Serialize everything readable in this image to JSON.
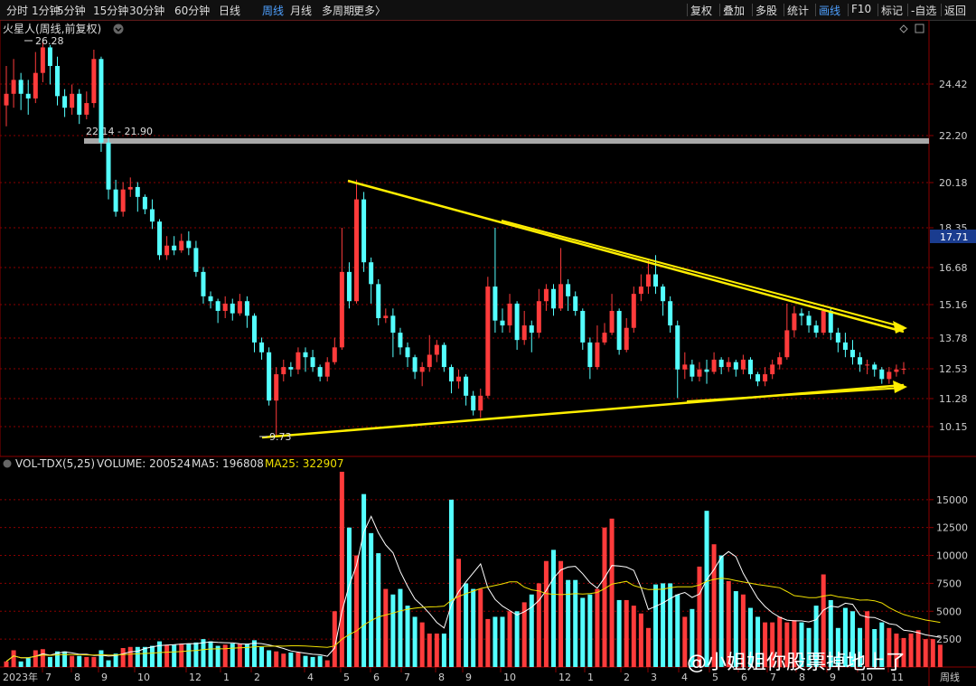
{
  "toolbar": {
    "left_items": [
      "分时",
      "1分钟",
      "5分钟",
      "15分钟",
      "30分钟",
      "60分钟",
      "日线",
      "周线",
      "月线",
      "多周期",
      "更多〉"
    ],
    "active_left": "周线",
    "right_items": [
      "复权",
      "叠加",
      "多股",
      "统计",
      "画线",
      "F10",
      "标记",
      "-自选",
      "返回"
    ],
    "active_right": "画线"
  },
  "header": {
    "title": "火星人(周线,前复权)",
    "dropdown_icon": "chevron-down-icon",
    "corner_icons": [
      "diamond-icon",
      "window-icon"
    ]
  },
  "colors": {
    "up": "#ff3b3b",
    "down": "#54ffff",
    "ma5": "#ffffff",
    "ma25": "#f0e000",
    "grid": "#8b0000",
    "trend": "#ffee00",
    "level": "#a8a8a8"
  },
  "price_axis": {
    "ticks": [
      "24.42",
      "22.20",
      "20.18",
      "18.35",
      "16.68",
      "15.16",
      "13.78",
      "12.53",
      "11.28",
      "10.15"
    ],
    "current_price": "17.71"
  },
  "annotations": {
    "high_label": "26.28",
    "low_label": "9.73",
    "level_label": "22.14 - 21.90"
  },
  "volume": {
    "indicator": "VOL-TDX(5,25)",
    "volume_label": "VOLUME: 200524",
    "ma5_label": "MA5: 196808",
    "ma25_label": "MA25: 322907",
    "ticks": [
      "15000",
      "12500",
      "10000",
      "7500",
      "5000",
      "2500"
    ]
  },
  "time_axis": {
    "labels": [
      "2023年",
      "7",
      "8",
      "9",
      "10",
      "12",
      "1",
      "2",
      "4",
      "5",
      "6",
      "7",
      "8",
      "9",
      "10",
      "12",
      "1",
      "2",
      "3",
      "4",
      "5",
      "6",
      "7",
      "8",
      "9",
      "10",
      "11"
    ],
    "period_label": "周线"
  },
  "watermark": "@小姐姐你股票掉地上了",
  "chart_data": {
    "type": "candlestick",
    "title": "火星人(周线,前复权)",
    "y_axis_ticks": [
      24.42,
      22.2,
      20.18,
      18.35,
      16.68,
      15.16,
      13.78,
      12.53,
      11.28,
      10.15
    ],
    "annotated_high": 26.28,
    "annotated_low": 9.73,
    "current_price": 17.71,
    "horizontal_level": [
      22.14,
      21.9
    ],
    "series": [
      {
        "name": "MA5"
      },
      {
        "name": "MA25"
      }
    ],
    "ohlc": [
      [
        23.5,
        24.0,
        25.2,
        22.6
      ],
      [
        24.0,
        24.6,
        25.5,
        23.4
      ],
      [
        24.6,
        24.0,
        24.9,
        23.3
      ],
      [
        24.0,
        23.8,
        24.6,
        23.1
      ],
      [
        23.8,
        24.9,
        25.8,
        23.6
      ],
      [
        24.9,
        26.0,
        26.28,
        24.5
      ],
      [
        26.0,
        25.2,
        26.1,
        24.4
      ],
      [
        25.2,
        23.9,
        25.6,
        23.5
      ],
      [
        23.9,
        23.4,
        24.2,
        23.0
      ],
      [
        23.4,
        24.0,
        24.4,
        23.1
      ],
      [
        24.0,
        23.1,
        24.2,
        22.7
      ],
      [
        23.1,
        23.6,
        24.1,
        22.9
      ],
      [
        23.6,
        25.5,
        25.9,
        23.4
      ],
      [
        25.5,
        21.9,
        25.6,
        21.5
      ],
      [
        21.9,
        19.9,
        22.1,
        19.5
      ],
      [
        19.9,
        19.0,
        20.3,
        18.8
      ],
      [
        19.0,
        19.9,
        20.2,
        18.8
      ],
      [
        19.9,
        20.0,
        20.4,
        19.6
      ],
      [
        20.0,
        19.6,
        20.2,
        19.0
      ],
      [
        19.6,
        19.1,
        19.7,
        18.9
      ],
      [
        19.1,
        18.6,
        19.5,
        18.3
      ],
      [
        18.6,
        17.2,
        18.7,
        17.0
      ],
      [
        17.2,
        17.6,
        18.0,
        17.0
      ],
      [
        17.6,
        17.4,
        18.0,
        17.2
      ],
      [
        17.4,
        17.8,
        18.1,
        17.3
      ],
      [
        17.8,
        17.5,
        18.2,
        17.2
      ],
      [
        17.5,
        16.5,
        17.8,
        16.3
      ],
      [
        16.5,
        15.5,
        16.7,
        15.2
      ],
      [
        15.5,
        15.3,
        15.7,
        15.0
      ],
      [
        15.3,
        14.9,
        15.4,
        14.4
      ],
      [
        14.9,
        15.2,
        15.5,
        14.6
      ],
      [
        15.2,
        14.8,
        15.4,
        14.5
      ],
      [
        14.8,
        15.3,
        15.6,
        14.7
      ],
      [
        15.3,
        14.7,
        15.5,
        14.2
      ],
      [
        14.7,
        13.6,
        14.8,
        13.2
      ],
      [
        13.6,
        13.2,
        13.8,
        12.9
      ],
      [
        13.2,
        11.2,
        13.4,
        11.0
      ],
      [
        11.2,
        12.3,
        12.6,
        9.73
      ],
      [
        12.3,
        12.6,
        12.9,
        12.0
      ],
      [
        12.6,
        12.5,
        12.8,
        12.2
      ],
      [
        12.5,
        13.2,
        13.4,
        12.3
      ],
      [
        13.2,
        13.0,
        13.4,
        12.4
      ],
      [
        13.0,
        12.6,
        13.3,
        12.4
      ],
      [
        12.6,
        12.2,
        12.7,
        12.0
      ],
      [
        12.2,
        12.8,
        13.0,
        12.0
      ],
      [
        12.8,
        13.4,
        13.8,
        12.7
      ],
      [
        13.4,
        16.5,
        18.35,
        13.3
      ],
      [
        16.5,
        15.3,
        16.9,
        15.0
      ],
      [
        15.3,
        19.5,
        20.3,
        15.2
      ],
      [
        19.5,
        16.9,
        19.8,
        16.5
      ],
      [
        16.9,
        16.0,
        17.1,
        15.2
      ],
      [
        16.0,
        14.6,
        16.2,
        14.3
      ],
      [
        14.6,
        14.7,
        15.0,
        14.4
      ],
      [
        14.7,
        14.0,
        15.0,
        13.0
      ],
      [
        14.0,
        13.4,
        14.2,
        13.1
      ],
      [
        13.4,
        13.0,
        13.6,
        12.6
      ],
      [
        13.0,
        12.4,
        13.1,
        12.1
      ],
      [
        12.4,
        12.6,
        12.8,
        11.8
      ],
      [
        12.6,
        13.1,
        13.9,
        12.4
      ],
      [
        13.1,
        13.5,
        13.7,
        12.8
      ],
      [
        13.5,
        12.6,
        13.6,
        12.4
      ],
      [
        12.6,
        12.0,
        12.7,
        11.5
      ],
      [
        12.0,
        12.2,
        12.5,
        11.7
      ],
      [
        12.2,
        11.4,
        12.3,
        11.0
      ],
      [
        11.4,
        10.8,
        11.6,
        10.6
      ],
      [
        10.8,
        11.4,
        11.7,
        10.5
      ],
      [
        11.4,
        15.9,
        16.3,
        11.3
      ],
      [
        15.9,
        14.5,
        18.35,
        14.0
      ],
      [
        14.5,
        14.3,
        15.0,
        14.0
      ],
      [
        14.3,
        15.2,
        15.6,
        14.0
      ],
      [
        15.2,
        13.7,
        15.3,
        13.3
      ],
      [
        13.7,
        14.3,
        14.9,
        13.5
      ],
      [
        14.3,
        14.0,
        14.5,
        13.2
      ],
      [
        14.0,
        15.3,
        15.8,
        13.8
      ],
      [
        15.3,
        15.8,
        16.0,
        14.9
      ],
      [
        15.8,
        15.0,
        16.0,
        14.7
      ],
      [
        15.0,
        16.0,
        17.5,
        14.9
      ],
      [
        16.0,
        15.5,
        16.2,
        14.9
      ],
      [
        15.5,
        14.9,
        15.7,
        14.7
      ],
      [
        14.9,
        13.6,
        15.0,
        13.3
      ],
      [
        13.6,
        12.6,
        13.8,
        12.1
      ],
      [
        12.6,
        13.6,
        14.3,
        12.5
      ],
      [
        13.6,
        14.0,
        14.4,
        13.5
      ],
      [
        14.0,
        14.9,
        15.6,
        13.9
      ],
      [
        14.9,
        13.3,
        15.0,
        13.1
      ],
      [
        13.3,
        14.2,
        14.6,
        13.2
      ],
      [
        14.2,
        15.6,
        15.9,
        14.0
      ],
      [
        15.6,
        15.9,
        16.4,
        15.3
      ],
      [
        15.9,
        16.4,
        17.0,
        15.6
      ],
      [
        16.4,
        15.9,
        17.2,
        15.6
      ],
      [
        15.9,
        15.3,
        16.0,
        14.7
      ],
      [
        15.3,
        14.3,
        15.5,
        14.0
      ],
      [
        14.3,
        12.5,
        14.5,
        11.3
      ],
      [
        12.5,
        12.7,
        13.2,
        12.1
      ],
      [
        12.7,
        12.2,
        12.9,
        12.0
      ],
      [
        12.2,
        12.5,
        12.8,
        12.0
      ],
      [
        12.5,
        12.4,
        12.9,
        11.9
      ],
      [
        12.4,
        12.9,
        13.2,
        12.3
      ],
      [
        12.9,
        12.6,
        13.0,
        12.3
      ],
      [
        12.6,
        12.8,
        13.0,
        12.4
      ],
      [
        12.8,
        12.5,
        12.9,
        12.2
      ],
      [
        12.5,
        12.9,
        13.1,
        12.3
      ],
      [
        12.9,
        12.3,
        13.0,
        12.1
      ],
      [
        12.3,
        12.0,
        12.4,
        11.8
      ],
      [
        12.0,
        12.3,
        12.6,
        11.8
      ],
      [
        12.3,
        12.7,
        12.9,
        12.1
      ],
      [
        12.7,
        13.0,
        13.2,
        12.5
      ],
      [
        13.0,
        14.1,
        15.2,
        12.9
      ],
      [
        14.1,
        14.8,
        15.1,
        13.8
      ],
      [
        14.8,
        14.7,
        15.0,
        14.3
      ],
      [
        14.7,
        14.3,
        14.9,
        14.0
      ],
      [
        14.3,
        14.0,
        14.5,
        13.8
      ],
      [
        14.0,
        14.9,
        15.0,
        13.9
      ],
      [
        14.9,
        14.0,
        15.0,
        13.7
      ],
      [
        14.0,
        13.6,
        14.2,
        13.2
      ],
      [
        13.6,
        13.3,
        14.0,
        13.0
      ],
      [
        13.3,
        13.0,
        13.7,
        12.7
      ],
      [
        13.0,
        12.7,
        13.2,
        12.4
      ],
      [
        12.7,
        12.7,
        12.9,
        12.3
      ],
      [
        12.7,
        12.5,
        12.8,
        12.2
      ],
      [
        12.5,
        12.1,
        12.6,
        11.9
      ],
      [
        12.1,
        12.4,
        12.6,
        11.9
      ],
      [
        12.4,
        12.5,
        12.7,
        12.2
      ],
      [
        12.5,
        12.53,
        12.8,
        12.3
      ]
    ],
    "volume": [
      500,
      1500,
      500,
      800,
      1500,
      1600,
      900,
      1400,
      1400,
      1000,
      1000,
      900,
      900,
      1500,
      600,
      1200,
      1700,
      1800,
      1800,
      1800,
      1900,
      2300,
      2000,
      2000,
      2100,
      2100,
      2200,
      2500,
      2300,
      1900,
      2000,
      2100,
      2100,
      2100,
      2400,
      1800,
      1500,
      1400,
      1200,
      1300,
      1300,
      1000,
      900,
      1000,
      600,
      5000,
      17500,
      12500,
      10000,
      15500,
      12000,
      10200,
      7000,
      6500,
      7000,
      5500,
      4500,
      4000,
      3000,
      3000,
      3000,
      15000,
      9700,
      7500,
      7000,
      7000,
      4300,
      4500,
      4500,
      5000,
      5000,
      5800,
      6500,
      7500,
      9500,
      10500,
      9500,
      7800,
      7800,
      6200,
      6500,
      7000,
      12500,
      13300,
      6000,
      6000,
      5500,
      4800,
      3500,
      7400,
      7500,
      7500,
      6500,
      4500,
      5200,
      9000,
      14000,
      11000,
      10000,
      7700,
      6800,
      6500,
      5300,
      4500,
      4000,
      4000,
      4500,
      4000,
      4200,
      4000,
      3500,
      5500,
      8300,
      6000,
      3500,
      5300,
      5000,
      3500,
      5000,
      3400,
      4000,
      3500,
      3000,
      2600,
      3000,
      3300,
      2500,
      2500,
      2000
    ]
  }
}
